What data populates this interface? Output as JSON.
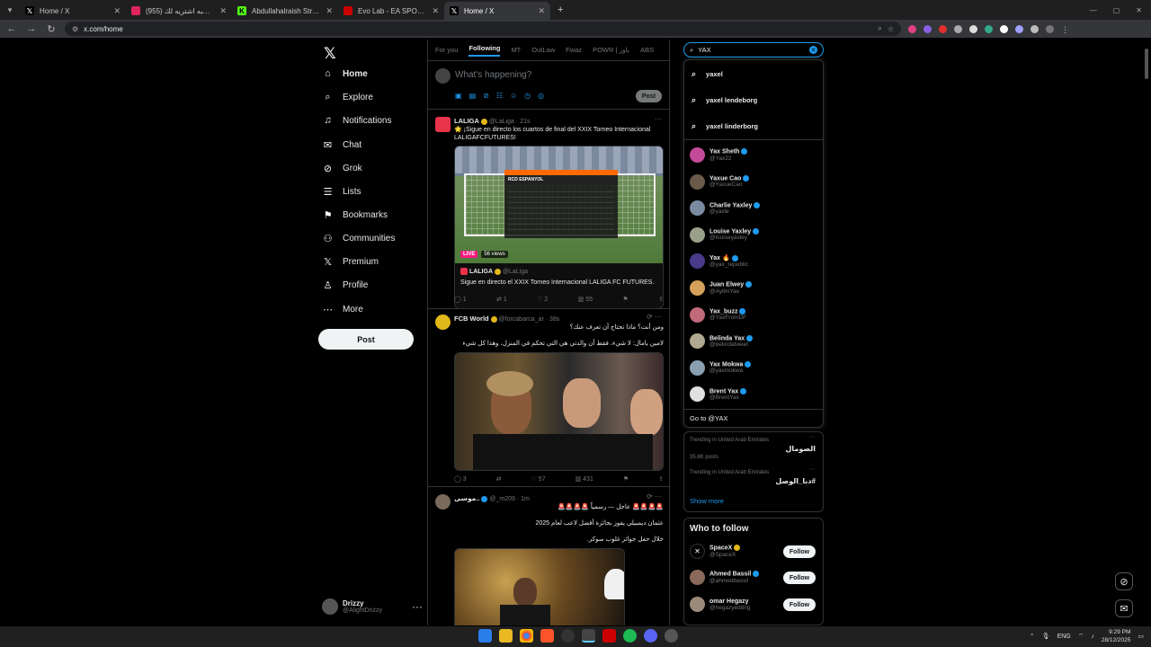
{
  "browser": {
    "tabs": [
      {
        "title": "Home / X",
        "active": false
      },
      {
        "title": "اي شي للسبه اشتريه لك (955)",
        "active": false
      },
      {
        "title": "Abdullahalraish Stream - Watch",
        "active": false
      },
      {
        "title": "Evo Lab - EA SPORTS FC 26 - Pi",
        "active": false
      },
      {
        "title": "Home / X",
        "active": true
      }
    ],
    "url": "x.com/home"
  },
  "nav": {
    "items": [
      {
        "label": "Home",
        "icon": "home-icon"
      },
      {
        "label": "Explore",
        "icon": "search-icon"
      },
      {
        "label": "Notifications",
        "icon": "bell-icon"
      },
      {
        "label": "Chat",
        "icon": "mail-icon"
      },
      {
        "label": "Grok",
        "icon": "grok-icon"
      },
      {
        "label": "Lists",
        "icon": "list-icon"
      },
      {
        "label": "Bookmarks",
        "icon": "bookmark-icon"
      },
      {
        "label": "Communities",
        "icon": "people-icon"
      },
      {
        "label": "Premium",
        "icon": "x-icon"
      },
      {
        "label": "Profile",
        "icon": "person-icon"
      },
      {
        "label": "More",
        "icon": "more-icon"
      }
    ],
    "post_label": "Post",
    "account": {
      "name": "Drizzy",
      "handle": "@AlightDrizzy"
    }
  },
  "feed": {
    "tabs": [
      "For you",
      "Following",
      "MT",
      "OutLaw",
      "Fwaz",
      "POWR | باور",
      "ABS"
    ],
    "composer_placeholder": "What's happening?",
    "composer_post": "Post",
    "tweets": [
      {
        "name": "LALIGA",
        "handle": "@LaLiga",
        "time": "21s",
        "text": "🌟 ¡Sigue en directo los cuartos de final del XXIX Torneo Internacional LALIGAFCFUTURES!",
        "live": "LIVE",
        "views": "56 views",
        "card_name": "LALIGA",
        "card_handle": "@LaLiga",
        "card_text": "Sigue en directo el XXIX Torneo Internacional LALIGA FC FUTURES.",
        "scoreboard_title": "RCD ESPANYOL",
        "actions": [
          "1",
          "1",
          "2",
          "55"
        ]
      },
      {
        "name": "FCB World",
        "handle": "@forcabarca_ar",
        "time": "38s",
        "text1": "ومن أنت؟ ماذا تحتاج أن تعرف عنك؟",
        "text2": "لامين يامال: لا شيء، فقط أن والدتي هي التي تحكم في المنزل، وهذا كل شيء",
        "actions": [
          "3",
          "",
          "57",
          "431"
        ]
      },
      {
        "name": "موسى..",
        "handle": "@_m209",
        "time": "1m",
        "text1": "🚨🚨🚨🚨 عاجل — رسمياً 🚨🚨🚨🚨",
        "text2": "عثمان ديمبيلي يفوز بجائزة أفضل لاعب لعام 2025",
        "text3": "خلال حفل جوائز غلوب سوكر."
      }
    ]
  },
  "search": {
    "query": "YAX",
    "suggestions": [
      "yaxel",
      "yaxel lendeborg",
      "yaxel linderborg"
    ],
    "users": [
      {
        "name": "Yax Sheth",
        "handle": "@Yax22",
        "color": "#c44a9a"
      },
      {
        "name": "Yaxue Cao",
        "handle": "@YaxueCao",
        "color": "#6a5a4a"
      },
      {
        "name": "Charlie Yaxley",
        "handle": "@yaxle",
        "color": "#7a8aa0"
      },
      {
        "name": "Louise Yaxley",
        "handle": "@louiseyaxley",
        "color": "#9aa08a"
      },
      {
        "name": "Yax 🔥",
        "handle": "@yax_republic",
        "color": "#4a3a8a"
      },
      {
        "name": "Juan Elwey",
        "handle": "@AyllmYax",
        "color": "#d4a05a"
      },
      {
        "name": "Yax_buzz",
        "handle": "@YaxFromDF",
        "color": "#c06a7a"
      },
      {
        "name": "Belinda Yax",
        "handle": "@belindatweet",
        "color": "#b0a890"
      },
      {
        "name": "Yax Mokwa",
        "handle": "@yaxmokwa",
        "color": "#8aa0b0"
      },
      {
        "name": "Brent Yax",
        "handle": "@BrentYax",
        "color": "#e0e0e0"
      }
    ],
    "goto": "Go to @YAX"
  },
  "trends": [
    {
      "context": "Trending in United Arab Emirates",
      "name": "الصومال",
      "posts": "35.8K posts"
    },
    {
      "context": "Trending in United Arab Emirates",
      "name": "#دبا_الوصل",
      "posts": ""
    }
  ],
  "show_more": "Show more",
  "who_to_follow": {
    "title": "Who to follow",
    "follow_label": "Follow",
    "accounts": [
      {
        "name": "SpaceX",
        "handle": "@SpaceX"
      },
      {
        "name": "Ahmed Bassil",
        "handle": "@ahmedbassil"
      },
      {
        "name": "omar Hegazy",
        "handle": "@hegazyeditng"
      }
    ]
  },
  "taskbar": {
    "lang": "ENG",
    "time": "9:29 PM",
    "date": "28/12/2025"
  }
}
